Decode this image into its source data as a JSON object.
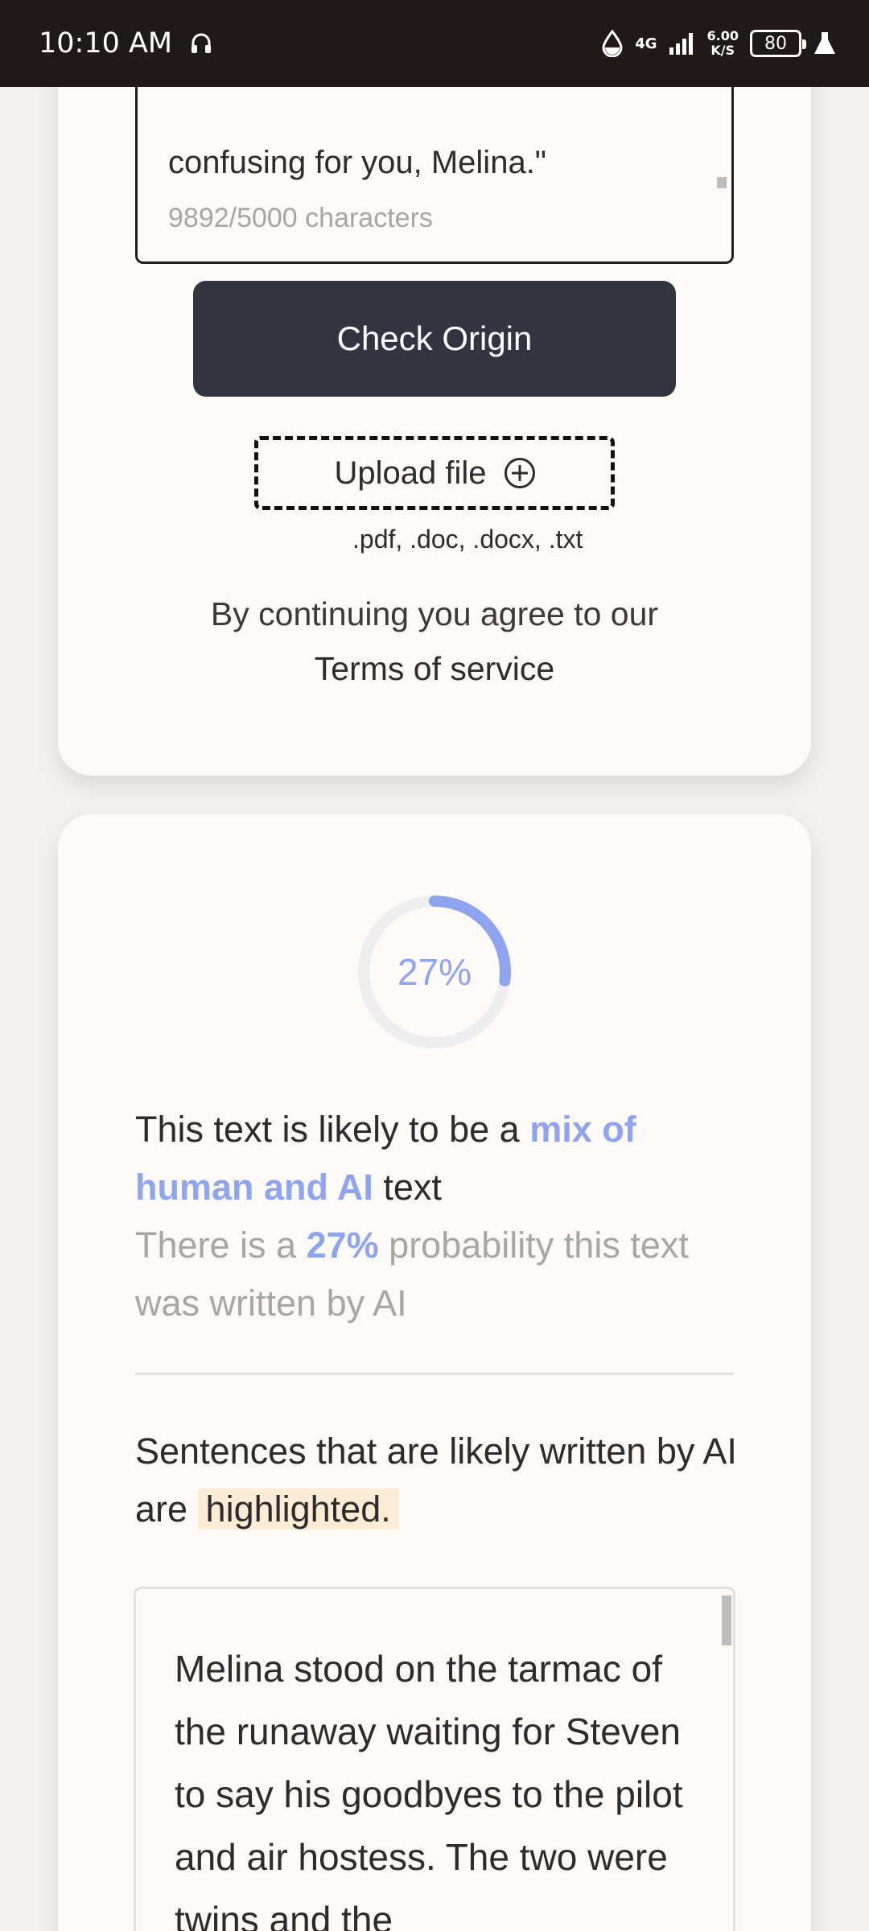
{
  "status_bar": {
    "time": "10:10 AM",
    "network": "4G",
    "speed_value": "6.00",
    "speed_unit": "K/S",
    "battery": "80",
    "icons": [
      "headphones-icon",
      "data-saver-icon",
      "signal-icon",
      "battery-icon",
      "lab-flask-icon"
    ]
  },
  "input_section": {
    "text_tail": "confusing for you, Melina.\"",
    "char_count": "9892/5000 characters",
    "check_button": "Check Origin",
    "upload_button": "Upload file",
    "file_types": ".pdf, .doc, .docx, .txt",
    "agree_text": "By continuing you agree to our",
    "terms_link": "Terms of service"
  },
  "result": {
    "gauge_value": 0.27,
    "gauge_label": "27%",
    "verdict_prefix": "This text is likely to be a ",
    "verdict_highlight": "mix of human and AI",
    "verdict_suffix": " text",
    "probability_prefix": "There is a ",
    "probability_value": "27%",
    "probability_suffix": " probability this text was written by AI",
    "sentences_note_prefix": "Sentences that are likely written by AI are ",
    "sentences_note_highlight": "highlighted.",
    "analyzed_text": "Melina stood on the tarmac of the runaway waiting for Steven to say his goodbyes to the pilot and air hostess. The two were twins and the"
  },
  "colors": {
    "accent": "#8fa4ee",
    "button_dark": "#323540",
    "highlight": "#fcecd5",
    "status_bar": "#1f1a18"
  }
}
